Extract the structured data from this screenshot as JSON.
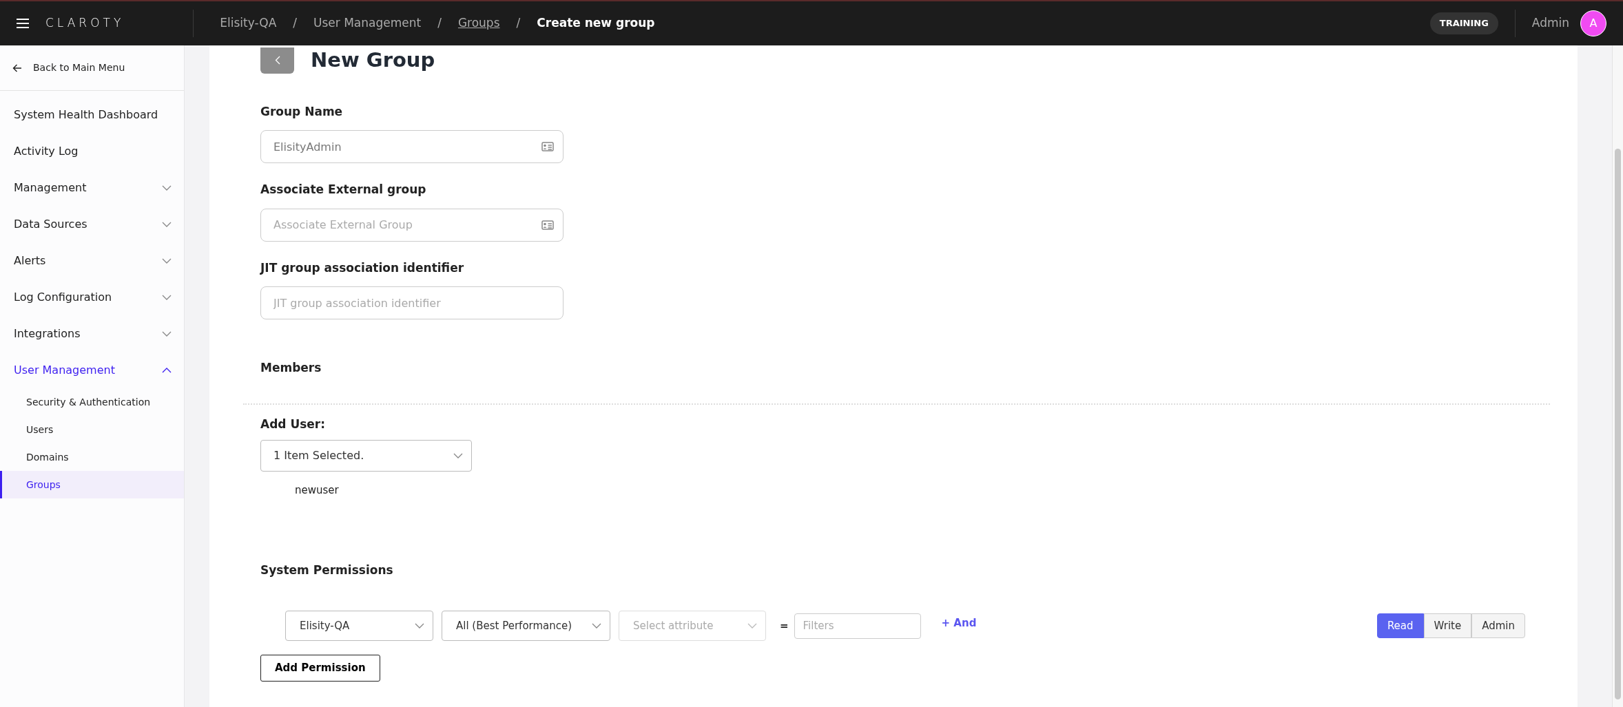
{
  "topbar": {
    "logo": "CLAROTY",
    "breadcrumbs": [
      {
        "label": "Elisity-QA",
        "kind": "plain"
      },
      {
        "label": "User Management",
        "kind": "plain"
      },
      {
        "label": "Groups",
        "kind": "link"
      },
      {
        "label": "Create new group",
        "kind": "current"
      }
    ],
    "separator": "/",
    "badge": "TRAINING",
    "user": {
      "name": "Admin",
      "initial": "A"
    }
  },
  "sidebar": {
    "back": "Back to Main Menu",
    "items": [
      {
        "label": "System Health Dashboard",
        "kind": "link",
        "selected": false
      },
      {
        "label": "Activity Log",
        "kind": "link",
        "selected": false
      },
      {
        "label": "Management",
        "kind": "group",
        "expanded": false,
        "selected": false
      },
      {
        "label": "Data Sources",
        "kind": "group",
        "expanded": false,
        "selected": false
      },
      {
        "label": "Alerts",
        "kind": "group",
        "expanded": false,
        "selected": false
      },
      {
        "label": "Log Configuration",
        "kind": "group",
        "expanded": false,
        "selected": false
      },
      {
        "label": "Integrations",
        "kind": "group",
        "expanded": false,
        "selected": false
      },
      {
        "label": "User Management",
        "kind": "group",
        "expanded": true,
        "selected": true,
        "children": [
          {
            "label": "Security & Authentication",
            "selected": false
          },
          {
            "label": "Users",
            "selected": false
          },
          {
            "label": "Domains",
            "selected": false
          },
          {
            "label": "Groups",
            "selected": true
          }
        ]
      }
    ]
  },
  "form": {
    "title": "New Group",
    "fields": [
      {
        "label": "Group Name",
        "value": "ElisityAdmin",
        "icon": true
      },
      {
        "label": "Associate External group",
        "placeholder": "Associate External Group",
        "icon": true
      },
      {
        "label": "JIT group association identifier",
        "placeholder": "JIT group association identifier",
        "icon": false
      }
    ]
  },
  "members": {
    "heading": "Members",
    "add_user_label": "Add User:",
    "select_value": "1 Item Selected.",
    "users": [
      "newuser"
    ]
  },
  "permissions": {
    "heading": "System Permissions",
    "rules": [
      {
        "site": "Elisity-QA",
        "scope": "All (Best Performance)",
        "attribute_placeholder": "Select attribute",
        "operator": "=",
        "filter_placeholder": "Filters",
        "and_label": "+ And",
        "access": [
          {
            "label": "Read",
            "selected": true
          },
          {
            "label": "Write",
            "selected": false
          },
          {
            "label": "Admin",
            "selected": false
          }
        ]
      }
    ],
    "add_button": "Add Permission"
  }
}
